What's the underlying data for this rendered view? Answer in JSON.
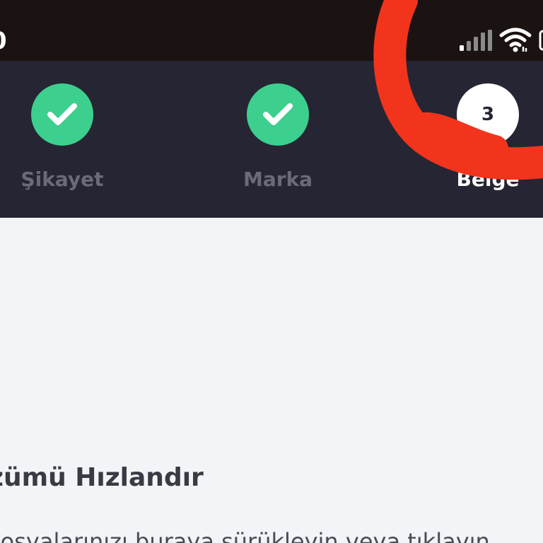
{
  "status_bar": {
    "time": "0"
  },
  "stepper": {
    "steps": [
      {
        "label": "Şikayet",
        "state": "done"
      },
      {
        "label": "Marka",
        "state": "done"
      },
      {
        "label": "Belge",
        "state": "current",
        "number": "3"
      }
    ]
  },
  "content": {
    "title": "zümü Hızlandır",
    "description": "Dosyalarınızı buraya sürükleyin veya tıklayın"
  },
  "colors": {
    "status_bar_bg": "#1b1212",
    "stepper_bg": "#262533",
    "done_green": "#3ccf8e",
    "marker_red": "#f2341c",
    "page_bg": "#f3f4f8"
  }
}
